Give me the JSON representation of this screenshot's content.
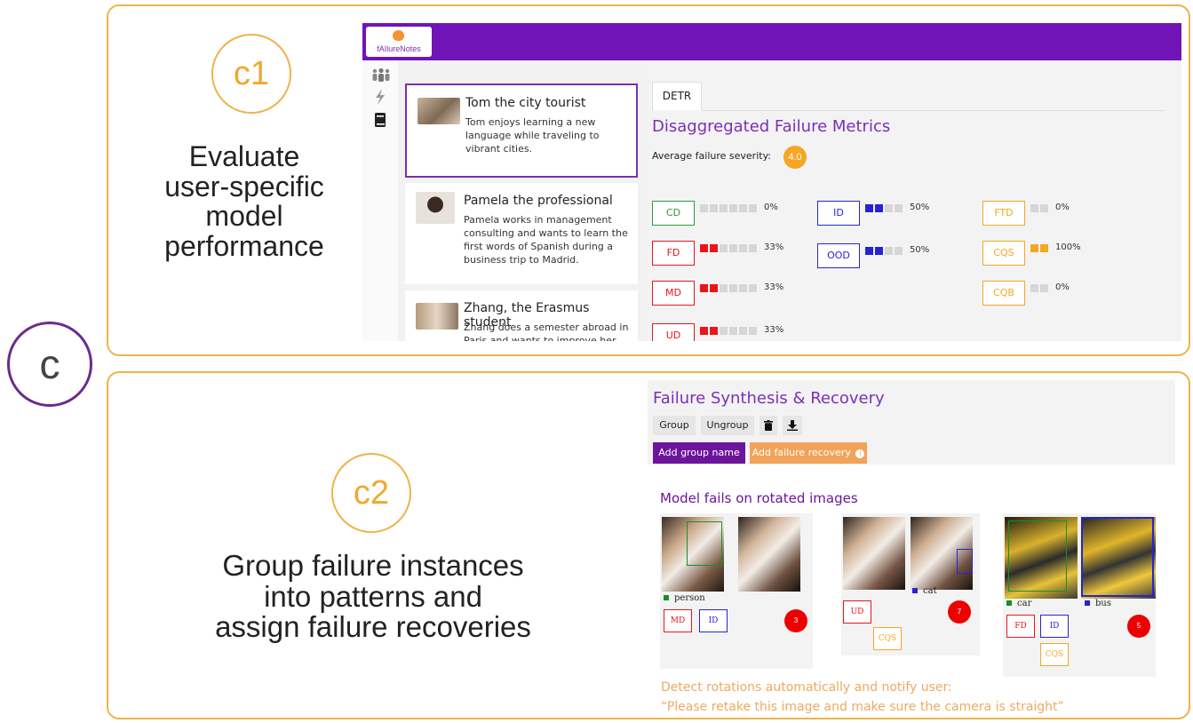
{
  "figure": {
    "main_label": "c",
    "c1": {
      "label": "c1",
      "text": [
        "Evaluate",
        "user-specific",
        "model",
        "performance"
      ]
    },
    "c2": {
      "label": "c2",
      "text": [
        "Group failure instances",
        "into patterns and",
        "assign failure recoveries"
      ]
    }
  },
  "app": {
    "logo_text": "fAIlureNotes",
    "sidebar_icons": [
      "people-icon",
      "bolt-icon",
      "book-icon"
    ],
    "personas": [
      {
        "name": "Tom the city tourist",
        "desc": "Tom enjoys learning a new language while traveling to vibrant cities.",
        "selected": true
      },
      {
        "name": "Pamela the professional",
        "desc": "Pamela works in management consulting and wants to learn the first words of Spanish during a business trip to Madrid.",
        "selected": false
      },
      {
        "name": "Zhang, the Erasmus student",
        "desc": "Zhang does a semester abroad in Paris and wants to improve her",
        "selected": false
      }
    ],
    "tab": "DETR",
    "metrics_title": "Disaggregated Failure Metrics",
    "avg_label": "Average failure severity:",
    "avg_value": "4.0",
    "metrics": [
      {
        "code": "CD",
        "pct": "0%",
        "filled": 0,
        "total": 6,
        "color": "#2e9b3a"
      },
      {
        "code": "FD",
        "pct": "33%",
        "filled": 2,
        "total": 6,
        "color": "#e8161b"
      },
      {
        "code": "MD",
        "pct": "33%",
        "filled": 2,
        "total": 6,
        "color": "#e8161b"
      },
      {
        "code": "UD",
        "pct": "33%",
        "filled": 2,
        "total": 6,
        "color": "#e8161b"
      },
      {
        "code": "ID",
        "pct": "50%",
        "filled": 2,
        "total": 4,
        "color": "#2424d6"
      },
      {
        "code": "OOD",
        "pct": "50%",
        "filled": 2,
        "total": 4,
        "color": "#2424d6"
      },
      {
        "code": "FTD",
        "pct": "0%",
        "filled": 0,
        "total": 2,
        "color": "#f5a623"
      },
      {
        "code": "CQS",
        "pct": "100%",
        "filled": 2,
        "total": 2,
        "color": "#f5a623"
      },
      {
        "code": "CQB",
        "pct": "0%",
        "filled": 0,
        "total": 2,
        "color": "#f5a623"
      }
    ]
  },
  "synthesis": {
    "title": "Failure Synthesis & Recovery",
    "buttons": {
      "group": "Group",
      "ungroup": "Ungroup",
      "add_group_name": "Add group name",
      "add_failure_recovery": "Add failure recovery"
    },
    "group_title": "Model fails on rotated images",
    "instances": [
      {
        "label": "person",
        "label_color": "#1a8f2a",
        "tags": [
          {
            "code": "MD",
            "color": "#e8161b"
          },
          {
            "code": "ID",
            "color": "#2424d6"
          }
        ],
        "count": "3"
      },
      {
        "label": "cat",
        "label_color": "#2424d6",
        "tags": [
          {
            "code": "UD",
            "color": "#e8161b"
          },
          {
            "code": "CQS",
            "color": "#f5a623"
          }
        ],
        "count": "7"
      },
      {
        "labels": [
          {
            "text": "car",
            "color": "#1a8f2a"
          },
          {
            "text": "bus",
            "color": "#2424d6"
          }
        ],
        "tags": [
          {
            "code": "FD",
            "color": "#e8161b"
          },
          {
            "code": "ID",
            "color": "#2424d6"
          },
          {
            "code": "CQS",
            "color": "#f5a623"
          }
        ],
        "count": "5"
      }
    ],
    "recovery_lines": [
      "Detect rotations automatically and notify user:",
      "“Please retake this image and make sure the camera is straight”"
    ]
  }
}
